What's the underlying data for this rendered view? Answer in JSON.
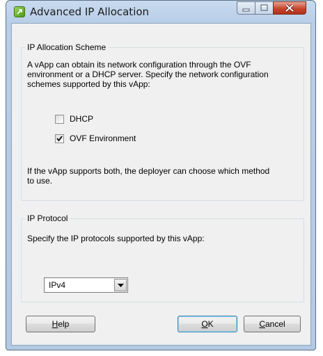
{
  "window": {
    "title": "Advanced IP Allocation",
    "controls": [
      "minimize-icon",
      "maximize-icon",
      "close-icon"
    ],
    "accent_color": "#c7452d"
  },
  "allocation_group": {
    "legend": "IP Allocation Scheme",
    "description_lines": [
      "A vApp can obtain its network configuration through the OVF",
      "environment or a DHCP server. Specify the network configuration",
      "schemes supported by this vApp:"
    ],
    "options": [
      {
        "label": "DHCP",
        "checked": false
      },
      {
        "label": "OVF Environment",
        "checked": true
      }
    ],
    "note_lines": [
      "If the vApp supports both, the deployer can choose which method",
      "to use."
    ]
  },
  "protocol_group": {
    "legend": "IP Protocol",
    "description": "Specify the IP protocols supported by this vApp:",
    "selected_protocol": "IPv4"
  },
  "buttons": {
    "help": {
      "mnemonic": "H",
      "rest": "elp"
    },
    "ok": {
      "mnemonic": "O",
      "rest": "K"
    },
    "cancel": {
      "mnemonic": "C",
      "rest": "ancel"
    }
  }
}
